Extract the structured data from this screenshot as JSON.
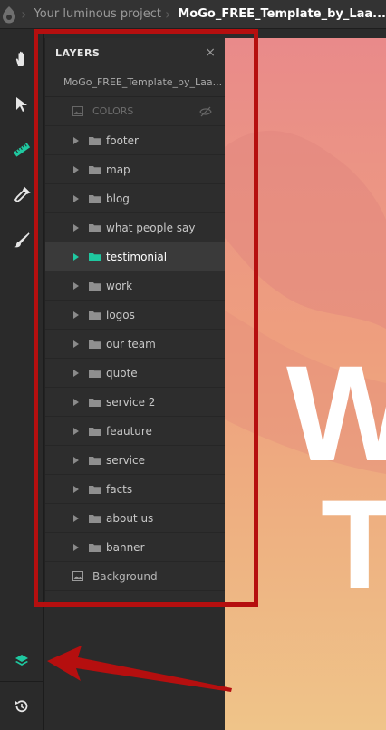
{
  "header": {
    "project_name": "Your luminous project",
    "file_name": "MoGo_FREE_Template_by_Laa..."
  },
  "toolbar": {
    "tools": [
      "hand-icon",
      "pointer-icon",
      "ruler-icon",
      "eyedropper-icon",
      "brush-icon"
    ],
    "bottom": [
      "layers-icon",
      "history-icon"
    ]
  },
  "layers_panel": {
    "title": "LAYERS",
    "close_label": "×",
    "project": "MoGo_FREE_Template_by_Laa...",
    "colors_label": "COLORS",
    "layers": [
      {
        "name": "footer",
        "selected": false
      },
      {
        "name": "map",
        "selected": false
      },
      {
        "name": "blog",
        "selected": false
      },
      {
        "name": "what people say",
        "selected": false
      },
      {
        "name": "testimonial",
        "selected": true
      },
      {
        "name": "work",
        "selected": false
      },
      {
        "name": "logos",
        "selected": false
      },
      {
        "name": "our team",
        "selected": false
      },
      {
        "name": "quote",
        "selected": false
      },
      {
        "name": "service 2",
        "selected": false
      },
      {
        "name": "feauture",
        "selected": false
      },
      {
        "name": "service",
        "selected": false
      },
      {
        "name": "facts",
        "selected": false
      },
      {
        "name": "about us",
        "selected": false
      },
      {
        "name": "banner",
        "selected": false
      }
    ],
    "background_label": "Background"
  },
  "canvas": {
    "hero_line_1": "W",
    "hero_line_2": "T"
  },
  "colors": {
    "accent": "#1fc8a0",
    "annotation_red": "#b50f0f"
  }
}
